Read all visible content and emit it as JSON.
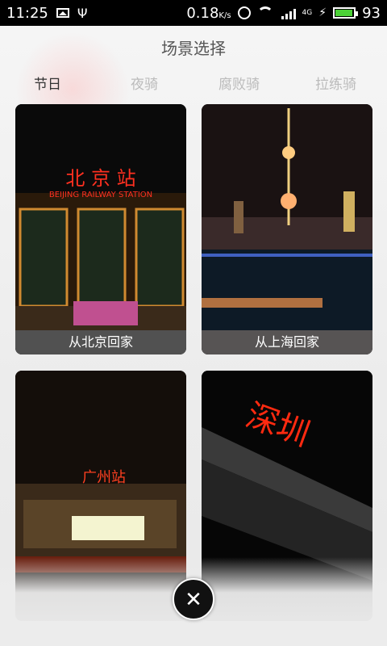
{
  "status_bar": {
    "time": "11:25",
    "network_speed": "0.18",
    "network_unit": "K/s",
    "network_type": "4G",
    "battery": "93",
    "icons": [
      "image-icon",
      "usb-icon",
      "alarm-icon",
      "wifi-icon",
      "signal-icon",
      "charging-icon",
      "battery-icon"
    ]
  },
  "page": {
    "title": "场景选择"
  },
  "tabs": [
    {
      "label": "节日",
      "active": true
    },
    {
      "label": "夜骑",
      "active": false
    },
    {
      "label": "腐败骑",
      "active": false
    },
    {
      "label": "拉练骑",
      "active": false
    }
  ],
  "scenes": [
    {
      "caption": "从北京回家",
      "sign_text": "北 京 站",
      "sign_sub": "BEIJING RAILWAY STATION"
    },
    {
      "caption": "从上海回家"
    },
    {
      "caption": "",
      "sign_text": "广州站"
    },
    {
      "caption": "",
      "sign_text": "深圳"
    }
  ],
  "controls": {
    "close_icon": "close-icon",
    "close_symbol": "✕"
  }
}
